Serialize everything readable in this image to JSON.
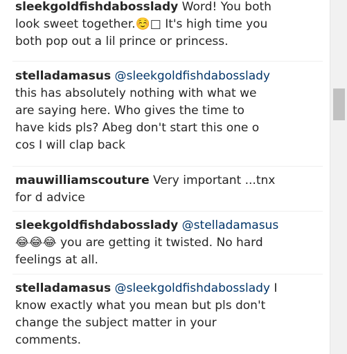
{
  "comments": [
    {
      "username": "sleekgoldfishdabosslady",
      "line1_text": " Word! You both",
      "line2_text": "look sweet together.☺️□ It's high time you",
      "line3_text": "both pop out a lil prince or princess."
    },
    {
      "username": "stelladamasus",
      "mention": "@sleekgoldfishdabosslady",
      "line2_text": "this has absolutely nothing with what we",
      "line3_text": "are saying here. Who gives the time to",
      "line4_text": "have kids pls? Abeg don't start this one o",
      "line5_text": "cos I will clap back"
    },
    {
      "username": "mauwilliamscouture",
      "line1_text": " Very important ...tnx",
      "line2_text": "for d advice"
    },
    {
      "username": "sleekgoldfishdabosslady",
      "mention": "@stelladamasus",
      "emojis": "😂😂😂",
      "line2_text": " you are getting it twisted. No hard",
      "line3_text": "feelings at all."
    },
    {
      "username": "stelladamasus",
      "mention": "@sleekgoldfishdabosslady",
      "line1_text": " I",
      "line2_text": "know exactly what you mean but pls don't",
      "line3_text": "change the subject matter in your",
      "line4_text": "comments."
    }
  ]
}
